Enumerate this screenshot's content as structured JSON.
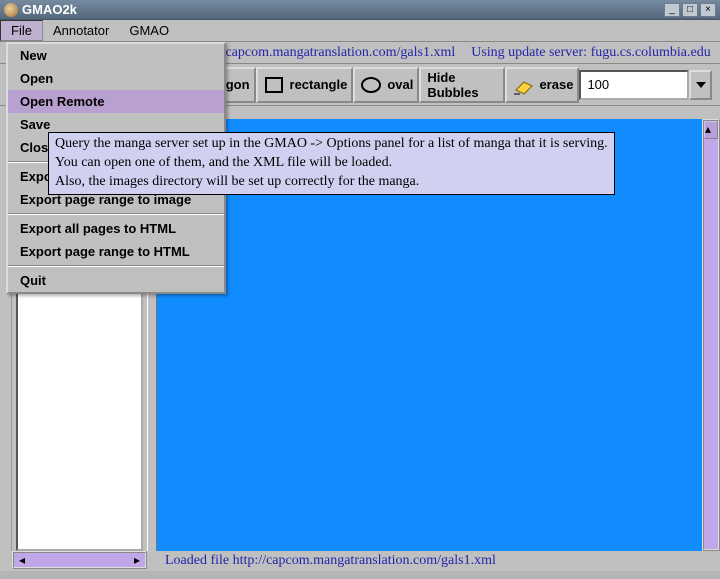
{
  "window": {
    "title": "GMAO2k"
  },
  "menubar": {
    "file": "File",
    "annotator": "Annotator",
    "gmao": "GMAO"
  },
  "urlbar": {
    "url": "http://capcom.mangatranslation.com/gals1.xml",
    "update": "Using update server: fugu.cs.columbia.edu"
  },
  "toolbar": {
    "polygon": "polygon",
    "rectangle": "rectangle",
    "oval": "oval",
    "hide_bubbles": "Hide Bubbles",
    "erase": "erase",
    "spin_value": "100"
  },
  "file_menu": {
    "new": "New",
    "open": "Open",
    "open_remote": "Open Remote",
    "save": "Save",
    "close": "Close",
    "export_image": "Export this page to image",
    "export_range_image": "Export page range to image",
    "export_html": "Export all pages to HTML",
    "export_range_html": "Export page range to HTML",
    "quit": "Quit"
  },
  "tooltip": {
    "l1": "Query the manga server set up in the GMAO -> Options panel for a list of manga that it is serving.",
    "l2": "You can open one of them, and the XML file will be loaded.",
    "l3": "Also, the images directory will be set up correctly for the manga."
  },
  "status": {
    "text": "Loaded file http://capcom.mangatranslation.com/gals1.xml"
  }
}
